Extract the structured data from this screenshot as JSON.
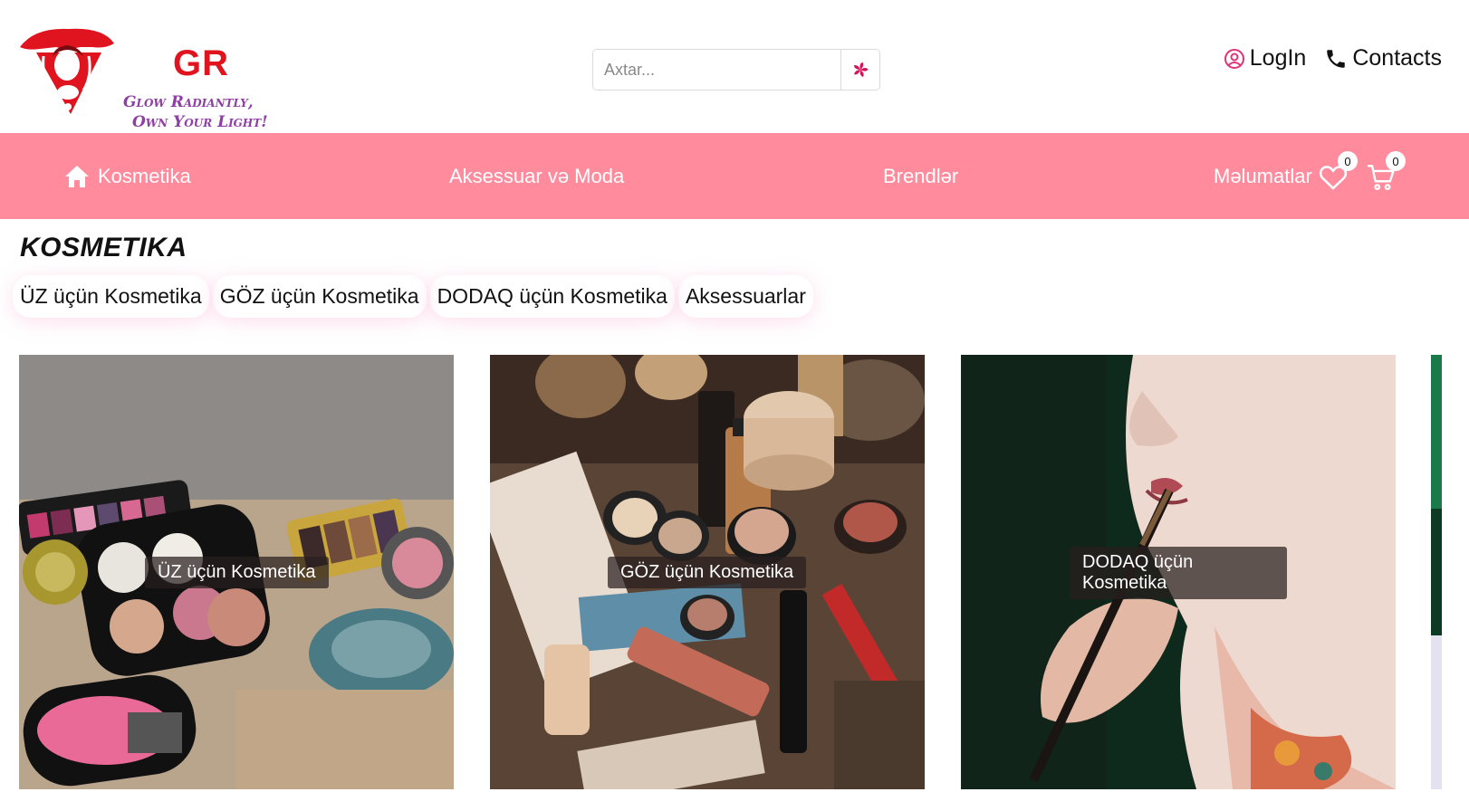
{
  "brand": {
    "short": "GR",
    "tagline_line1": "Glow Radiantly,",
    "tagline_line2": "Own Your Light!",
    "accent": "#e0141e",
    "tagline_color": "#8e3fa3"
  },
  "search": {
    "placeholder": "Axtar...",
    "value": ""
  },
  "top_links": {
    "login": "LogIn",
    "contacts": "Contacts"
  },
  "nav": {
    "bg_color": "#ff8b9d",
    "items": [
      {
        "label": "Kosmetika",
        "icon": "home-icon"
      },
      {
        "label": "Aksessuar və Moda"
      },
      {
        "label": "Brendlər"
      },
      {
        "label": "Məlumatlar"
      }
    ],
    "favorites_count": "0",
    "cart_count": "0"
  },
  "section": {
    "title": "KOSMETIKA",
    "sub_links": [
      "ÜZ üçün Kosmetika",
      "GÖZ üçün Kosmetika",
      "DODAQ üçün Kosmetika",
      "Aksessuarlar"
    ]
  },
  "cards": [
    {
      "label": "ÜZ üçün Kosmetika"
    },
    {
      "label": "GÖZ üçün Kosmetika"
    },
    {
      "label": "DODAQ üçün Kosmetika"
    }
  ]
}
